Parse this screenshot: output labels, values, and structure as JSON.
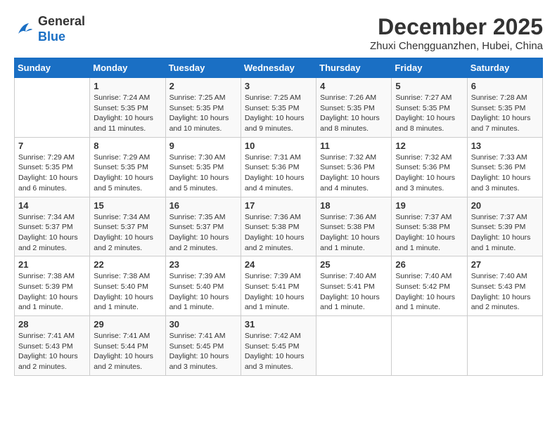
{
  "logo": {
    "general": "General",
    "blue": "Blue"
  },
  "title": "December 2025",
  "location": "Zhuxi Chengguanzhen, Hubei, China",
  "days_of_week": [
    "Sunday",
    "Monday",
    "Tuesday",
    "Wednesday",
    "Thursday",
    "Friday",
    "Saturday"
  ],
  "weeks": [
    [
      {
        "day": "",
        "info": ""
      },
      {
        "day": "1",
        "info": "Sunrise: 7:24 AM\nSunset: 5:35 PM\nDaylight: 10 hours\nand 11 minutes."
      },
      {
        "day": "2",
        "info": "Sunrise: 7:25 AM\nSunset: 5:35 PM\nDaylight: 10 hours\nand 10 minutes."
      },
      {
        "day": "3",
        "info": "Sunrise: 7:25 AM\nSunset: 5:35 PM\nDaylight: 10 hours\nand 9 minutes."
      },
      {
        "day": "4",
        "info": "Sunrise: 7:26 AM\nSunset: 5:35 PM\nDaylight: 10 hours\nand 8 minutes."
      },
      {
        "day": "5",
        "info": "Sunrise: 7:27 AM\nSunset: 5:35 PM\nDaylight: 10 hours\nand 8 minutes."
      },
      {
        "day": "6",
        "info": "Sunrise: 7:28 AM\nSunset: 5:35 PM\nDaylight: 10 hours\nand 7 minutes."
      }
    ],
    [
      {
        "day": "7",
        "info": "Sunrise: 7:29 AM\nSunset: 5:35 PM\nDaylight: 10 hours\nand 6 minutes."
      },
      {
        "day": "8",
        "info": "Sunrise: 7:29 AM\nSunset: 5:35 PM\nDaylight: 10 hours\nand 5 minutes."
      },
      {
        "day": "9",
        "info": "Sunrise: 7:30 AM\nSunset: 5:35 PM\nDaylight: 10 hours\nand 5 minutes."
      },
      {
        "day": "10",
        "info": "Sunrise: 7:31 AM\nSunset: 5:36 PM\nDaylight: 10 hours\nand 4 minutes."
      },
      {
        "day": "11",
        "info": "Sunrise: 7:32 AM\nSunset: 5:36 PM\nDaylight: 10 hours\nand 4 minutes."
      },
      {
        "day": "12",
        "info": "Sunrise: 7:32 AM\nSunset: 5:36 PM\nDaylight: 10 hours\nand 3 minutes."
      },
      {
        "day": "13",
        "info": "Sunrise: 7:33 AM\nSunset: 5:36 PM\nDaylight: 10 hours\nand 3 minutes."
      }
    ],
    [
      {
        "day": "14",
        "info": "Sunrise: 7:34 AM\nSunset: 5:37 PM\nDaylight: 10 hours\nand 2 minutes."
      },
      {
        "day": "15",
        "info": "Sunrise: 7:34 AM\nSunset: 5:37 PM\nDaylight: 10 hours\nand 2 minutes."
      },
      {
        "day": "16",
        "info": "Sunrise: 7:35 AM\nSunset: 5:37 PM\nDaylight: 10 hours\nand 2 minutes."
      },
      {
        "day": "17",
        "info": "Sunrise: 7:36 AM\nSunset: 5:38 PM\nDaylight: 10 hours\nand 2 minutes."
      },
      {
        "day": "18",
        "info": "Sunrise: 7:36 AM\nSunset: 5:38 PM\nDaylight: 10 hours\nand 1 minute."
      },
      {
        "day": "19",
        "info": "Sunrise: 7:37 AM\nSunset: 5:38 PM\nDaylight: 10 hours\nand 1 minute."
      },
      {
        "day": "20",
        "info": "Sunrise: 7:37 AM\nSunset: 5:39 PM\nDaylight: 10 hours\nand 1 minute."
      }
    ],
    [
      {
        "day": "21",
        "info": "Sunrise: 7:38 AM\nSunset: 5:39 PM\nDaylight: 10 hours\nand 1 minute."
      },
      {
        "day": "22",
        "info": "Sunrise: 7:38 AM\nSunset: 5:40 PM\nDaylight: 10 hours\nand 1 minute."
      },
      {
        "day": "23",
        "info": "Sunrise: 7:39 AM\nSunset: 5:40 PM\nDaylight: 10 hours\nand 1 minute."
      },
      {
        "day": "24",
        "info": "Sunrise: 7:39 AM\nSunset: 5:41 PM\nDaylight: 10 hours\nand 1 minute."
      },
      {
        "day": "25",
        "info": "Sunrise: 7:40 AM\nSunset: 5:41 PM\nDaylight: 10 hours\nand 1 minute."
      },
      {
        "day": "26",
        "info": "Sunrise: 7:40 AM\nSunset: 5:42 PM\nDaylight: 10 hours\nand 1 minute."
      },
      {
        "day": "27",
        "info": "Sunrise: 7:40 AM\nSunset: 5:43 PM\nDaylight: 10 hours\nand 2 minutes."
      }
    ],
    [
      {
        "day": "28",
        "info": "Sunrise: 7:41 AM\nSunset: 5:43 PM\nDaylight: 10 hours\nand 2 minutes."
      },
      {
        "day": "29",
        "info": "Sunrise: 7:41 AM\nSunset: 5:44 PM\nDaylight: 10 hours\nand 2 minutes."
      },
      {
        "day": "30",
        "info": "Sunrise: 7:41 AM\nSunset: 5:45 PM\nDaylight: 10 hours\nand 3 minutes."
      },
      {
        "day": "31",
        "info": "Sunrise: 7:42 AM\nSunset: 5:45 PM\nDaylight: 10 hours\nand 3 minutes."
      },
      {
        "day": "",
        "info": ""
      },
      {
        "day": "",
        "info": ""
      },
      {
        "day": "",
        "info": ""
      }
    ]
  ]
}
